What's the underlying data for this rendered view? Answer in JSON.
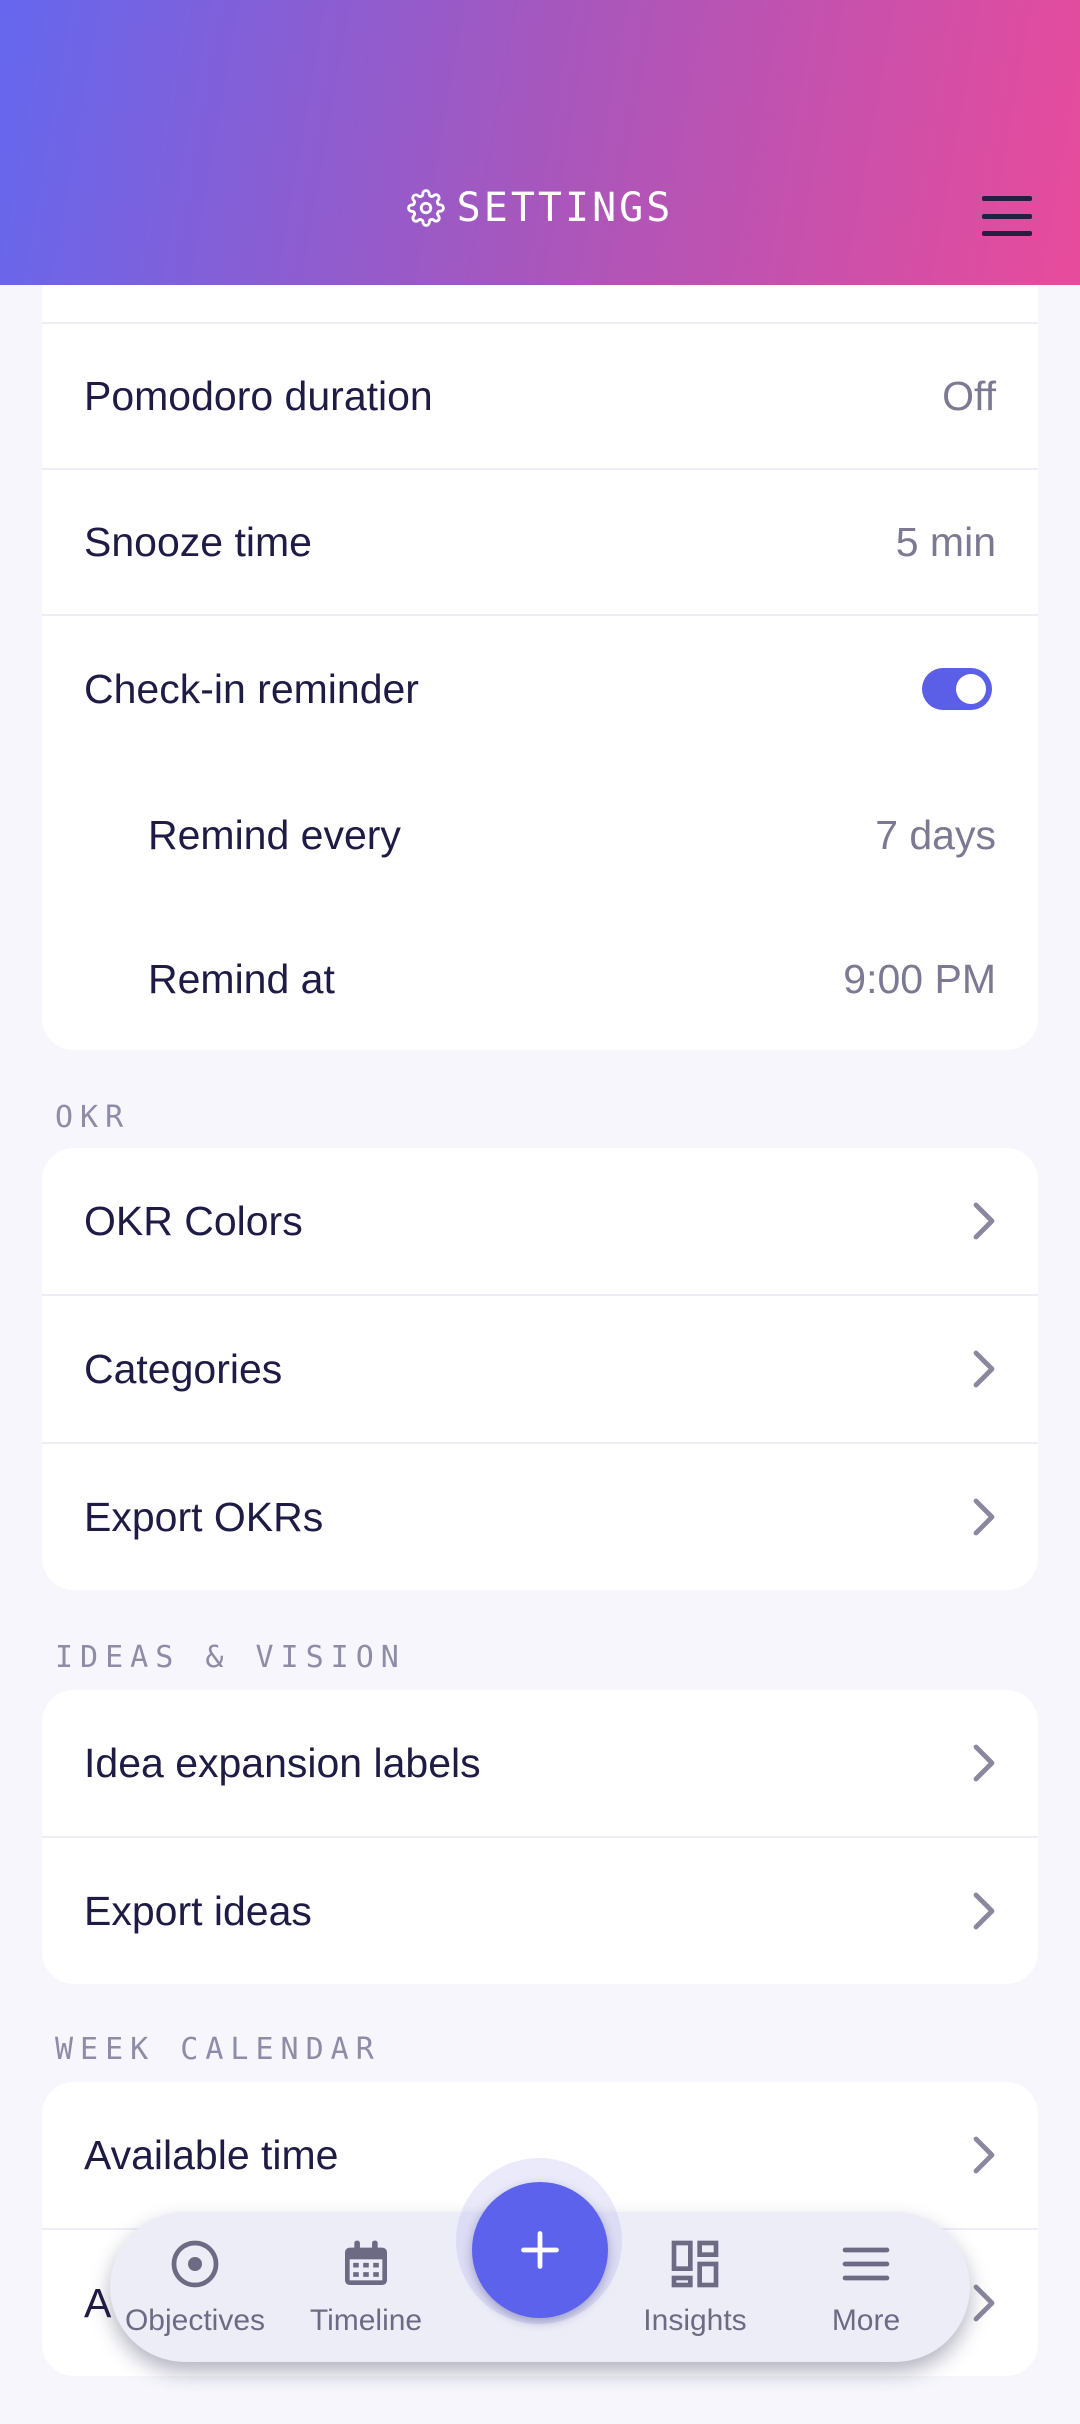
{
  "header": {
    "title": "SETTINGS",
    "settings_icon": "gear-icon",
    "menu_icon": "hamburger-menu-icon"
  },
  "reminders": {
    "pomodoro": {
      "label": "Pomodoro duration",
      "value": "Off"
    },
    "snooze": {
      "label": "Snooze time",
      "value": "5 min"
    },
    "checkin": {
      "label": "Check-in reminder",
      "enabled": true
    },
    "remind_every": {
      "label": "Remind every",
      "value": "7 days"
    },
    "remind_at": {
      "label": "Remind at",
      "value": "9:00 PM"
    }
  },
  "okr": {
    "section_title": "OKR",
    "items": [
      {
        "label": "OKR Colors"
      },
      {
        "label": "Categories"
      },
      {
        "label": "Export OKRs"
      }
    ]
  },
  "ideas": {
    "section_title": "IDEAS & VISION",
    "items": [
      {
        "label": "Idea expansion labels"
      },
      {
        "label": "Export ideas"
      }
    ]
  },
  "calendar": {
    "section_title": "WEEK CALENDAR",
    "items": [
      {
        "label": "Available time"
      },
      {
        "label": "A"
      }
    ]
  },
  "nav": {
    "items": [
      {
        "label": "Objectives",
        "icon": "target-icon"
      },
      {
        "label": "Timeline",
        "icon": "calendar-icon"
      },
      {
        "label": "Insights",
        "icon": "dashboard-icon"
      },
      {
        "label": "More",
        "icon": "menu-icon"
      }
    ],
    "fab_icon": "plus-icon"
  },
  "colors": {
    "accent": "#5c62ec",
    "gradient_start": "#6567ee",
    "gradient_end": "#e84b9b"
  }
}
